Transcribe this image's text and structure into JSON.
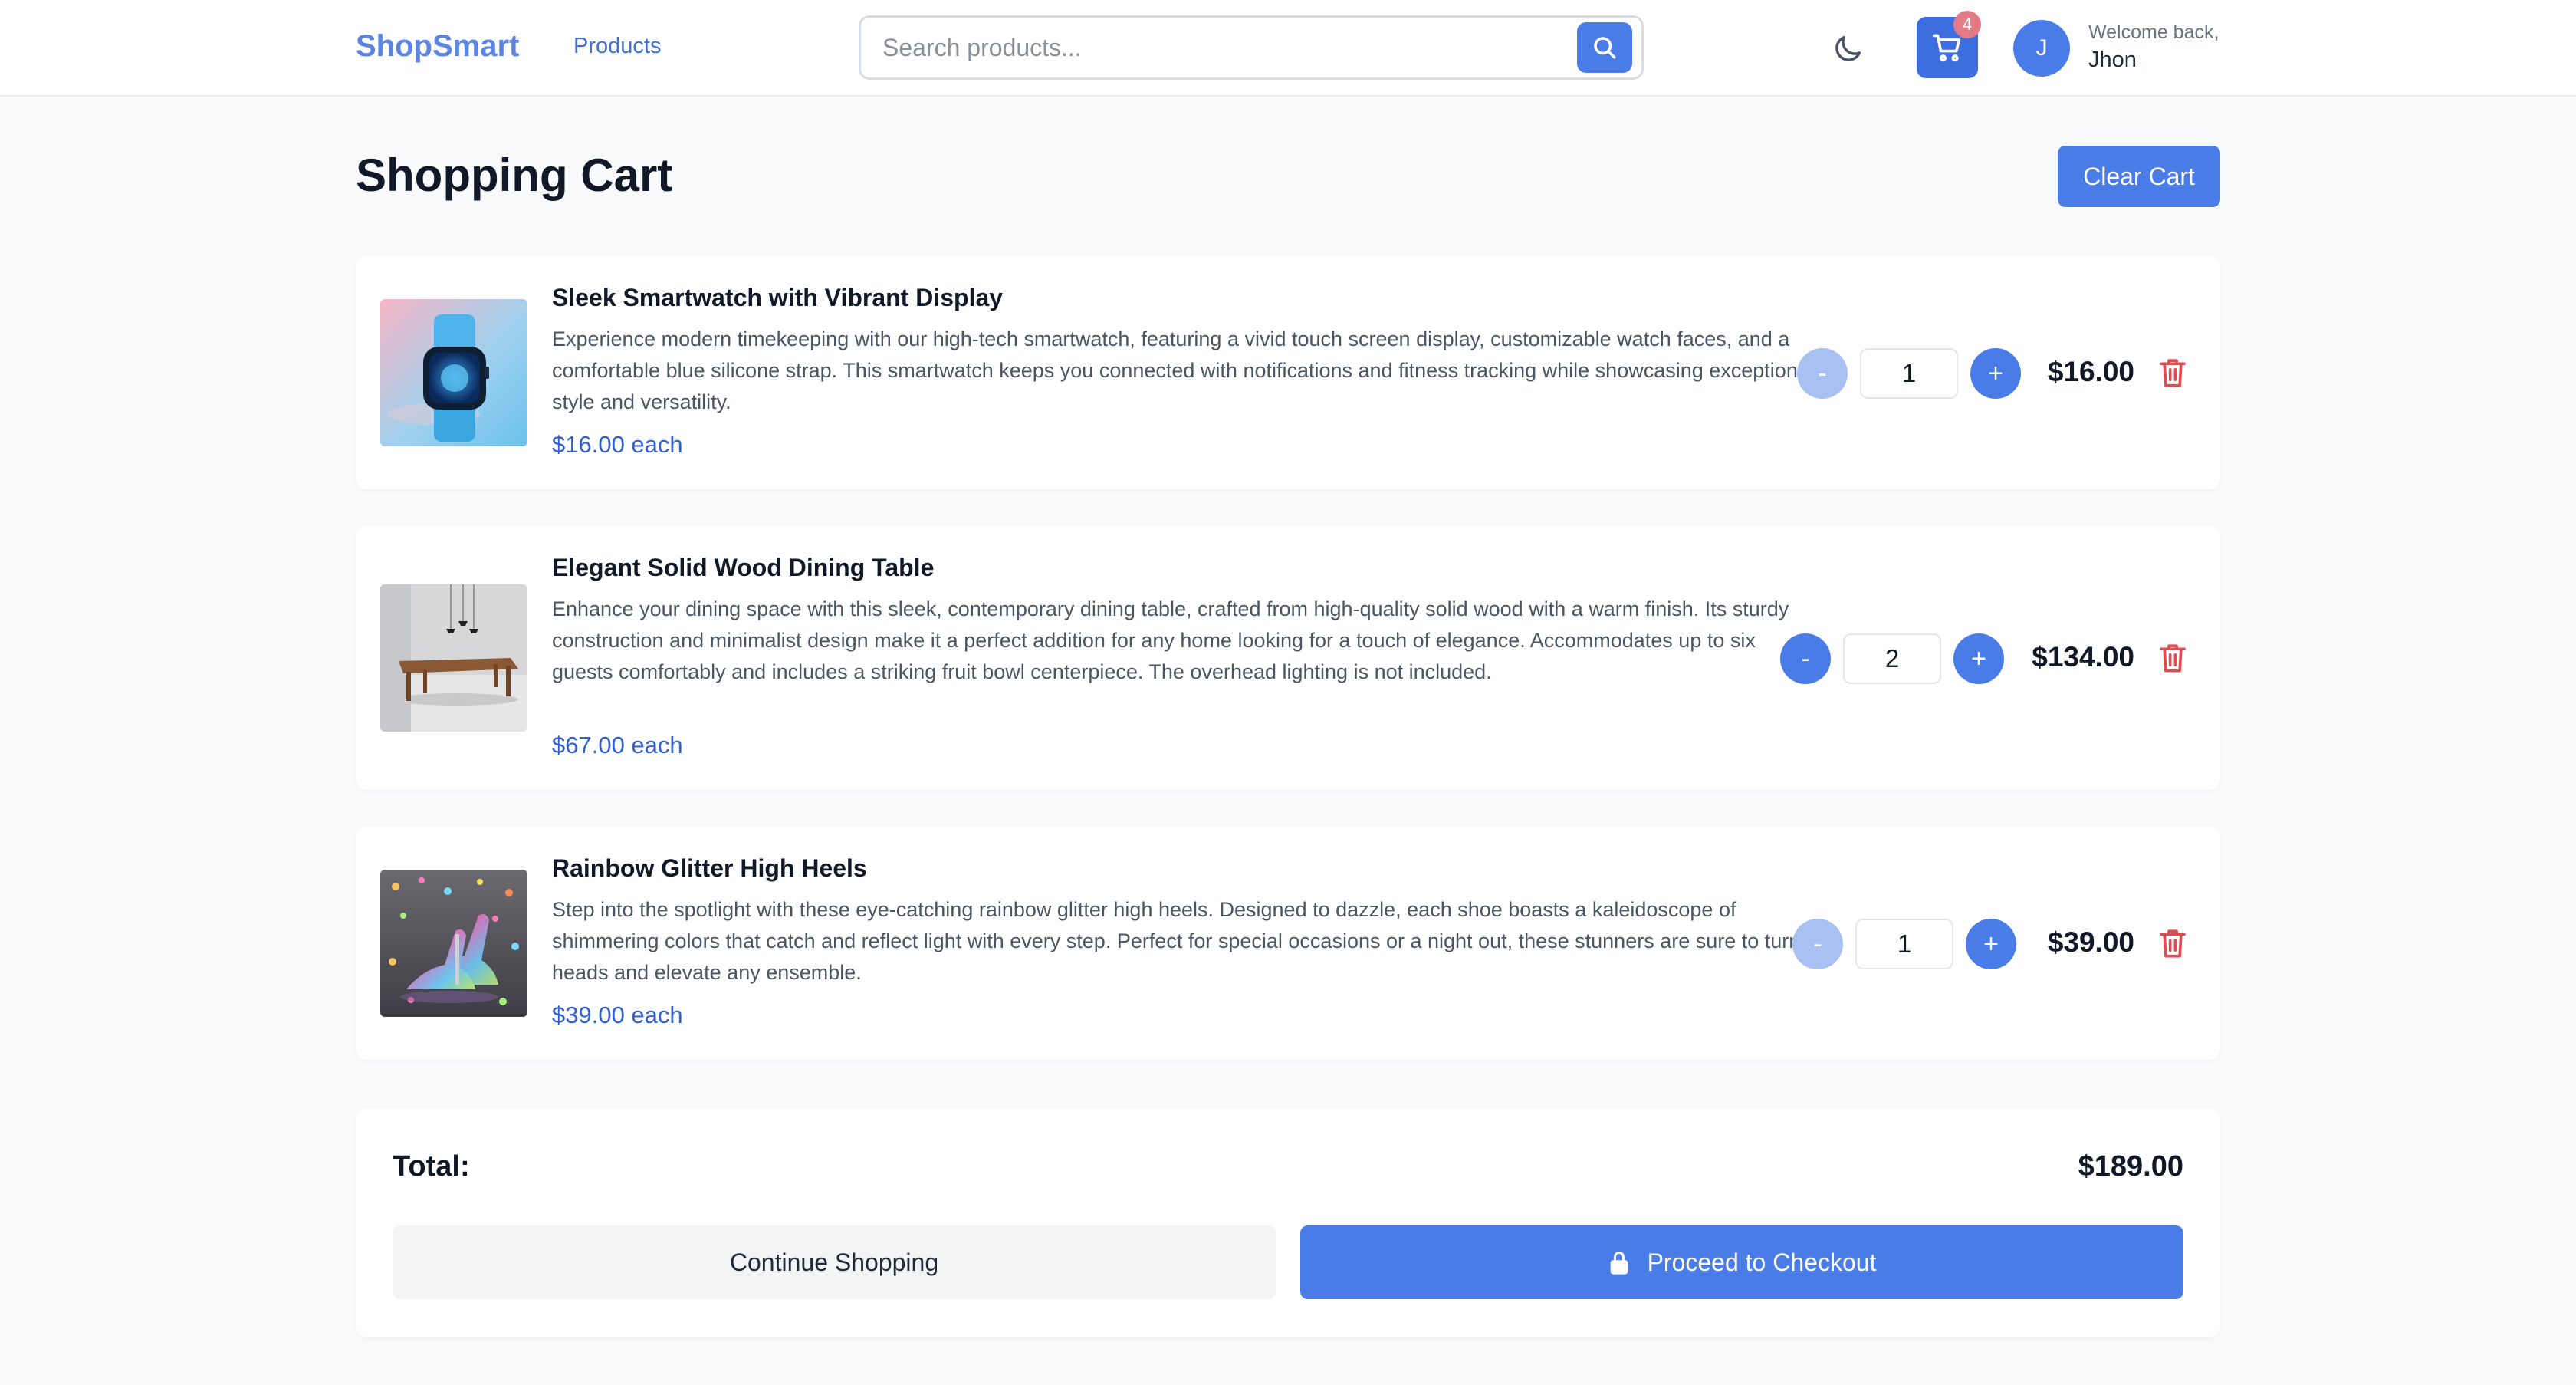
{
  "header": {
    "logo": "ShopSmart",
    "nav_products": "Products",
    "search_placeholder": "Search products...",
    "cart_count": "4",
    "avatar_initial": "J",
    "welcome": "Welcome back,",
    "username": "Jhon",
    "icons": {
      "search": "search-icon",
      "theme": "moon-icon",
      "cart": "cart-icon"
    }
  },
  "page": {
    "title": "Shopping Cart",
    "clear_cart": "Clear Cart"
  },
  "items": [
    {
      "name": "Sleek Smartwatch with Vibrant Display",
      "description": "Experience modern timekeeping with our high-tech smartwatch, featuring a vivid touch screen display, customizable watch faces, and a comfortable blue silicone strap. This smartwatch keeps you connected with notifications and fitness tracking while showcasing exceptional style and versatility.",
      "each": "$16.00 each",
      "quantity": "1",
      "line_total": "$16.00",
      "minus_label": "-",
      "plus_label": "+"
    },
    {
      "name": "Elegant Solid Wood Dining Table",
      "description": "Enhance your dining space with this sleek, contemporary dining table, crafted from high-quality solid wood with a warm finish. Its sturdy construction and minimalist design make it a perfect addition for any home looking for a touch of elegance. Accommodates up to six guests comfortably and includes a striking fruit bowl centerpiece. The overhead lighting is not included.",
      "each": "$67.00 each",
      "quantity": "2",
      "line_total": "$134.00",
      "minus_label": "-",
      "plus_label": "+"
    },
    {
      "name": "Rainbow Glitter High Heels",
      "description": "Step into the spotlight with these eye-catching rainbow glitter high heels. Designed to dazzle, each shoe boasts a kaleidoscope of shimmering colors that catch and reflect light with every step. Perfect for special occasions or a night out, these stunners are sure to turn heads and elevate any ensemble.",
      "each": "$39.00 each",
      "quantity": "1",
      "line_total": "$39.00",
      "minus_label": "-",
      "plus_label": "+"
    }
  ],
  "summary": {
    "total_label": "Total:",
    "total_value": "$189.00",
    "continue_shopping": "Continue Shopping",
    "checkout": "Proceed to Checkout"
  },
  "colors": {
    "accent": "#4a7ce8",
    "accent_light": "#a9c0f2",
    "logo": "#5b84e3",
    "price_link": "#2f5fd0",
    "danger": "#e5484d",
    "badge": "#e27b86"
  }
}
